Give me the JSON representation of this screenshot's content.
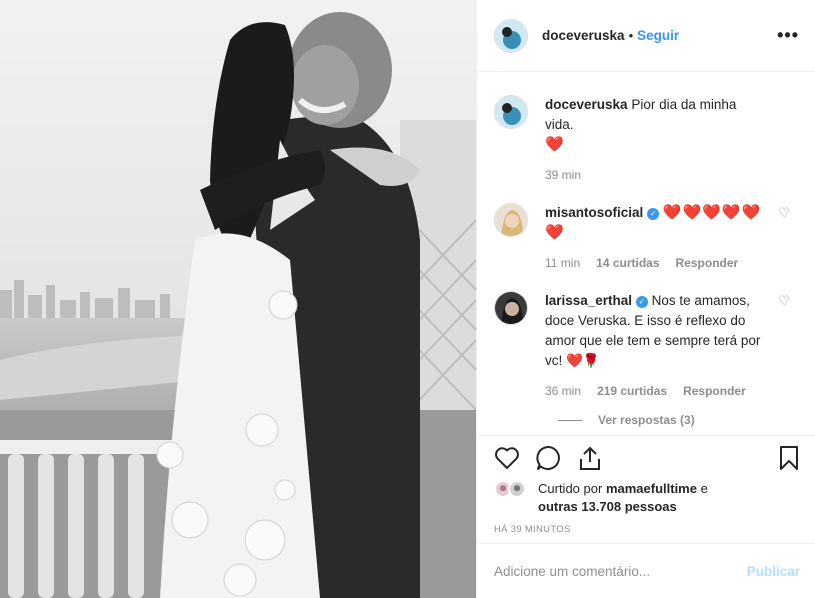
{
  "post": {
    "username": "doceveruska",
    "follow_label": "Seguir",
    "more_icon": "more-icon"
  },
  "caption": {
    "username": "doceveruska",
    "text": "Pior dia da minha vida.",
    "emoji": "❤️",
    "time": "39 min"
  },
  "comments": [
    {
      "username": "misantosoficial",
      "verified": true,
      "text": "❤️❤️❤️❤️❤️❤️",
      "time": "11 min",
      "likes": "14 curtidas",
      "reply_label": "Responder"
    },
    {
      "username": "larissa_erthal",
      "verified": true,
      "text": "Nos te amamos, doce Veruska. E isso é reflexo do amor que ele tem e sempre terá por vc! ❤️🌹",
      "time": "36 min",
      "likes": "219 curtidas",
      "reply_label": "Responder",
      "view_replies": "Ver respostas (3)"
    }
  ],
  "likes": {
    "prefix": "Curtido por",
    "user": "mamaefulltime",
    "connector": "e",
    "others": "outras 13.708 pessoas"
  },
  "timestamp": "HÁ 39 MINUTOS",
  "add_comment": {
    "placeholder": "Adicione um comentário...",
    "post_label": "Publicar"
  },
  "colors": {
    "link_blue": "#3897f0",
    "publish_disabled": "#b2dffc",
    "heart_red": "#d0021b",
    "muted": "#8e8e8e"
  }
}
